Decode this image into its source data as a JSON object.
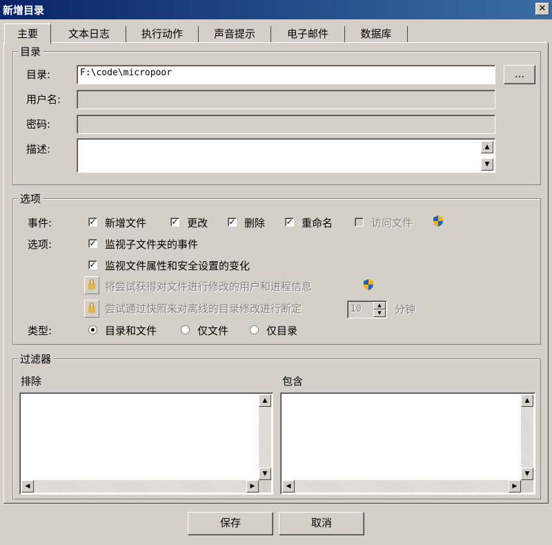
{
  "window": {
    "title": "新增目录",
    "close_glyph": "✕"
  },
  "tabs": [
    "主要",
    "文本日志",
    "执行动作",
    "声音提示",
    "电子邮件",
    "数据库"
  ],
  "directory_group": {
    "legend": "目录",
    "dir_label": "目录:",
    "dir_value": "F:\\code\\micropoor",
    "browse_label": "...",
    "user_label": "用户名:",
    "password_label": "密码:",
    "desc_label": "描述:"
  },
  "options_group": {
    "legend": "选项",
    "events_label": "事件:",
    "events": [
      {
        "label": "新增文件",
        "checked": true,
        "enabled": true
      },
      {
        "label": "更改",
        "checked": true,
        "enabled": true
      },
      {
        "label": "删除",
        "checked": true,
        "enabled": true
      },
      {
        "label": "重命名",
        "checked": true,
        "enabled": true
      },
      {
        "label": "访问文件",
        "checked": false,
        "enabled": false
      }
    ],
    "options_label": "选项:",
    "watch_subfolders": "监视子文件夹的事件",
    "watch_attributes": "监视文件属性和安全设置的变化",
    "record_user_info": "将尝试获得对文件进行修改的用户和进程信息",
    "snapshot_judgement": "尝试通过快照来对离线的目录修改进行断定",
    "snapshot_interval": "10",
    "minutes_label": "分钟",
    "type_label": "类型:",
    "types": [
      {
        "label": "目录和文件",
        "selected": true
      },
      {
        "label": "仅文件",
        "selected": false
      },
      {
        "label": "仅目录",
        "selected": false
      }
    ]
  },
  "filter_group": {
    "legend": "过滤器",
    "exclude_label": "排除",
    "include_label": "包含"
  },
  "footer": {
    "save_label": "保存",
    "cancel_label": "取消"
  },
  "colors": {
    "titlebar": "#0a246a",
    "face": "#d4d0c8",
    "shield_blue": "#1f5fbf",
    "shield_yellow": "#f2b400"
  }
}
